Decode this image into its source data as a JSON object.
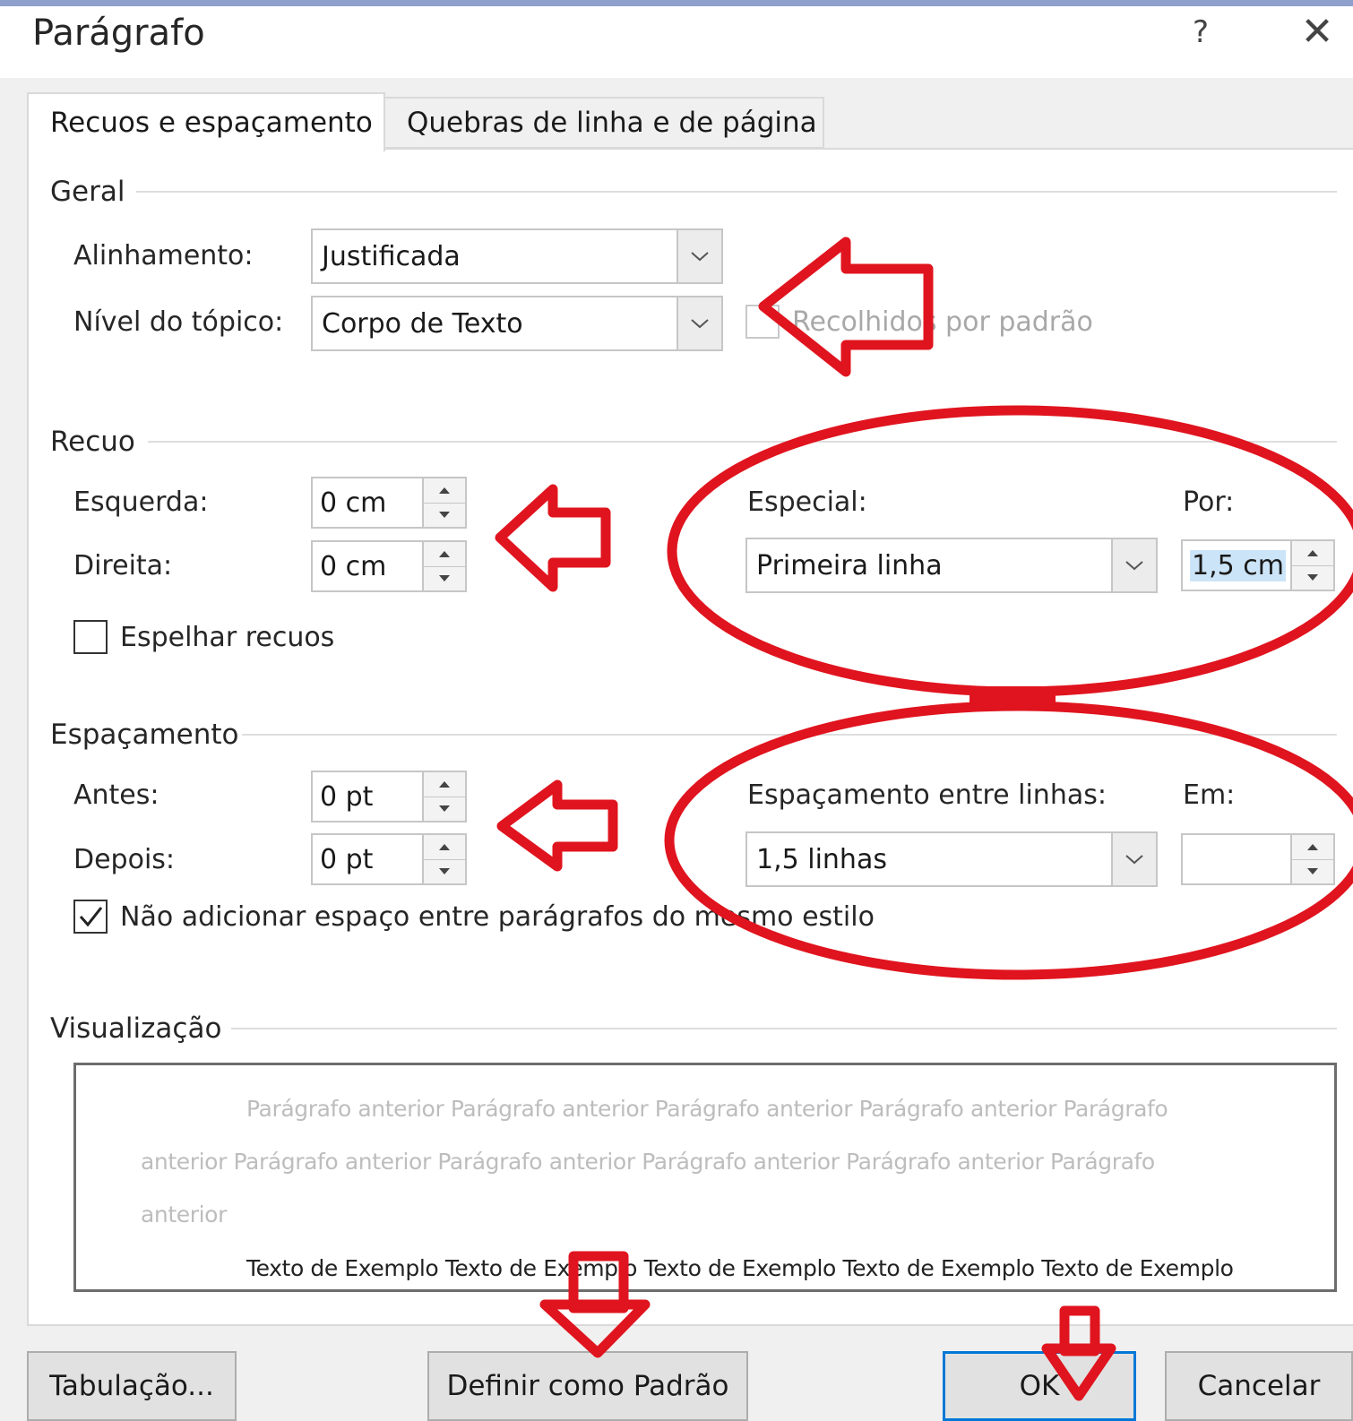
{
  "dialog": {
    "title": "Parágrafo",
    "help_label": "?",
    "close_label": "✕"
  },
  "tabs": [
    {
      "label": "Recuos e espaçamento",
      "active": true
    },
    {
      "label": "Quebras de linha e de página",
      "active": false
    }
  ],
  "geral": {
    "section": "Geral",
    "alinhamento_label": "Alinhamento:",
    "alinhamento_value": "Justificada",
    "nivel_label": "Nível do tópico:",
    "nivel_value": "Corpo de Texto",
    "recolhidos_label": "Recolhidos por padrão",
    "recolhidos_checked": false
  },
  "recuo": {
    "section": "Recuo",
    "esquerda_label": "Esquerda:",
    "esquerda_value": "0 cm",
    "direita_label": "Direita:",
    "direita_value": "0 cm",
    "especial_label": "Especial:",
    "especial_value": "Primeira linha",
    "por_label": "Por:",
    "por_value": "1,5 cm",
    "espelhar_label": "Espelhar recuos",
    "espelhar_checked": false
  },
  "espacamento": {
    "section": "Espaçamento",
    "antes_label": "Antes:",
    "antes_value": "0 pt",
    "depois_label": "Depois:",
    "depois_value": "0 pt",
    "entre_linhas_label": "Espaçamento entre linhas:",
    "entre_linhas_value": "1,5 linhas",
    "em_label": "Em:",
    "em_value": "",
    "nao_adicionar_label": "Não adicionar espaço entre parágrafos do mesmo estilo",
    "nao_adicionar_checked": true
  },
  "visualizacao": {
    "section": "Visualização",
    "lines": [
      "Parágrafo anterior Parágrafo anterior Parágrafo anterior Parágrafo anterior Parágrafo",
      "anterior Parágrafo anterior Parágrafo anterior Parágrafo anterior Parágrafo anterior Parágrafo",
      "anterior",
      "Texto de Exemplo Texto de Exemplo Texto de Exemplo Texto de Exemplo Texto de Exemplo"
    ]
  },
  "buttons": {
    "tabulacao": "Tabulação...",
    "definir_padrao": "Definir como Padrão",
    "ok": "OK",
    "cancelar": "Cancelar"
  },
  "colors": {
    "annotation": "#e0141e",
    "accent": "#0078d7",
    "selection": "#cce4f7"
  },
  "icons": {
    "dropdown": "chevron-down-icon",
    "spinner": "spin-up-down-icon",
    "check": "check-icon",
    "close": "close-icon",
    "annotation_arrow": "red-arrow-icon",
    "annotation_ellipse": "red-ellipse-icon"
  }
}
